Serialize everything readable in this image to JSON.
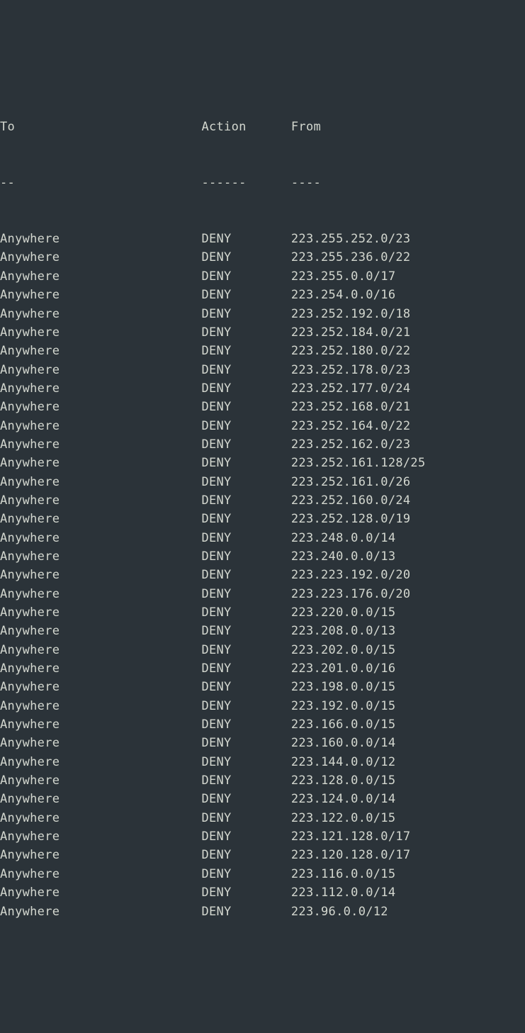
{
  "header": {
    "col1": "To",
    "col2": "Action",
    "col3": "From"
  },
  "separator": {
    "col1": "--",
    "col2": "------",
    "col3": "----"
  },
  "rules": [
    {
      "to": "Anywhere",
      "action": "DENY",
      "from": "223.255.252.0/23"
    },
    {
      "to": "Anywhere",
      "action": "DENY",
      "from": "223.255.236.0/22"
    },
    {
      "to": "Anywhere",
      "action": "DENY",
      "from": "223.255.0.0/17"
    },
    {
      "to": "Anywhere",
      "action": "DENY",
      "from": "223.254.0.0/16"
    },
    {
      "to": "Anywhere",
      "action": "DENY",
      "from": "223.252.192.0/18"
    },
    {
      "to": "Anywhere",
      "action": "DENY",
      "from": "223.252.184.0/21"
    },
    {
      "to": "Anywhere",
      "action": "DENY",
      "from": "223.252.180.0/22"
    },
    {
      "to": "Anywhere",
      "action": "DENY",
      "from": "223.252.178.0/23"
    },
    {
      "to": "Anywhere",
      "action": "DENY",
      "from": "223.252.177.0/24"
    },
    {
      "to": "Anywhere",
      "action": "DENY",
      "from": "223.252.168.0/21"
    },
    {
      "to": "Anywhere",
      "action": "DENY",
      "from": "223.252.164.0/22"
    },
    {
      "to": "Anywhere",
      "action": "DENY",
      "from": "223.252.162.0/23"
    },
    {
      "to": "Anywhere",
      "action": "DENY",
      "from": "223.252.161.128/25"
    },
    {
      "to": "Anywhere",
      "action": "DENY",
      "from": "223.252.161.0/26"
    },
    {
      "to": "Anywhere",
      "action": "DENY",
      "from": "223.252.160.0/24"
    },
    {
      "to": "Anywhere",
      "action": "DENY",
      "from": "223.252.128.0/19"
    },
    {
      "to": "Anywhere",
      "action": "DENY",
      "from": "223.248.0.0/14"
    },
    {
      "to": "Anywhere",
      "action": "DENY",
      "from": "223.240.0.0/13"
    },
    {
      "to": "Anywhere",
      "action": "DENY",
      "from": "223.223.192.0/20"
    },
    {
      "to": "Anywhere",
      "action": "DENY",
      "from": "223.223.176.0/20"
    },
    {
      "to": "Anywhere",
      "action": "DENY",
      "from": "223.220.0.0/15"
    },
    {
      "to": "Anywhere",
      "action": "DENY",
      "from": "223.208.0.0/13"
    },
    {
      "to": "Anywhere",
      "action": "DENY",
      "from": "223.202.0.0/15"
    },
    {
      "to": "Anywhere",
      "action": "DENY",
      "from": "223.201.0.0/16"
    },
    {
      "to": "Anywhere",
      "action": "DENY",
      "from": "223.198.0.0/15"
    },
    {
      "to": "Anywhere",
      "action": "DENY",
      "from": "223.192.0.0/15"
    },
    {
      "to": "Anywhere",
      "action": "DENY",
      "from": "223.166.0.0/15"
    },
    {
      "to": "Anywhere",
      "action": "DENY",
      "from": "223.160.0.0/14"
    },
    {
      "to": "Anywhere",
      "action": "DENY",
      "from": "223.144.0.0/12"
    },
    {
      "to": "Anywhere",
      "action": "DENY",
      "from": "223.128.0.0/15"
    },
    {
      "to": "Anywhere",
      "action": "DENY",
      "from": "223.124.0.0/14"
    },
    {
      "to": "Anywhere",
      "action": "DENY",
      "from": "223.122.0.0/15"
    },
    {
      "to": "Anywhere",
      "action": "DENY",
      "from": "223.121.128.0/17"
    },
    {
      "to": "Anywhere",
      "action": "DENY",
      "from": "223.120.128.0/17"
    },
    {
      "to": "Anywhere",
      "action": "DENY",
      "from": "223.116.0.0/15"
    },
    {
      "to": "Anywhere",
      "action": "DENY",
      "from": "223.112.0.0/14"
    },
    {
      "to": "Anywhere",
      "action": "DENY",
      "from": "223.96.0.0/12"
    }
  ],
  "colwidths": {
    "c1": 27,
    "c2": 12
  }
}
